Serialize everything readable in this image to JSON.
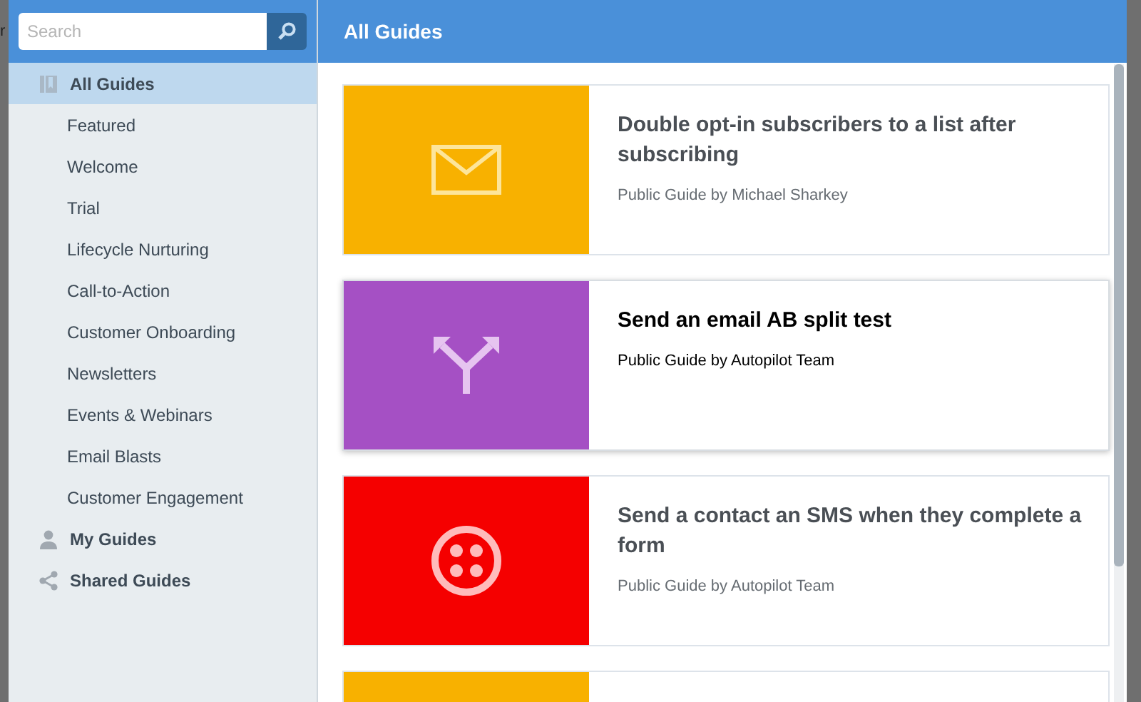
{
  "backdrop_text": "r",
  "search": {
    "placeholder": "Search"
  },
  "sidebar": {
    "items": [
      {
        "label": "All Guides",
        "selected": true,
        "children": [
          {
            "label": "Featured",
            "selected": false
          },
          {
            "label": "Welcome",
            "selected": false
          },
          {
            "label": "Trial",
            "selected": false
          },
          {
            "label": "Lifecycle Nurturing",
            "selected": false
          },
          {
            "label": "Call-to-Action",
            "selected": false
          },
          {
            "label": "Customer Onboarding",
            "selected": false
          },
          {
            "label": "Newsletters",
            "selected": false
          },
          {
            "label": "Events & Webinars",
            "selected": false
          },
          {
            "label": "Email Blasts",
            "selected": false
          },
          {
            "label": "Customer Engagement",
            "selected": false
          }
        ]
      },
      {
        "label": "My Guides",
        "selected": false
      },
      {
        "label": "Shared Guides",
        "selected": false
      }
    ]
  },
  "header": {
    "title": "All Guides"
  },
  "guides": [
    {
      "title": "Double opt-in subscribers to a list after subscribing",
      "byline": "Public Guide by Michael Sharkey",
      "color": "#f8b100",
      "highlighted": false
    },
    {
      "title": "Send an email AB split test",
      "byline": "Public Guide by Autopilot Team",
      "color": "#a550c4",
      "highlighted": true
    },
    {
      "title": "Send a contact an SMS when they complete a form",
      "byline": "Public Guide by Autopilot Team",
      "color": "#f50000",
      "highlighted": false
    },
    {
      "color": "#f8b100",
      "highlighted": false
    }
  ]
}
